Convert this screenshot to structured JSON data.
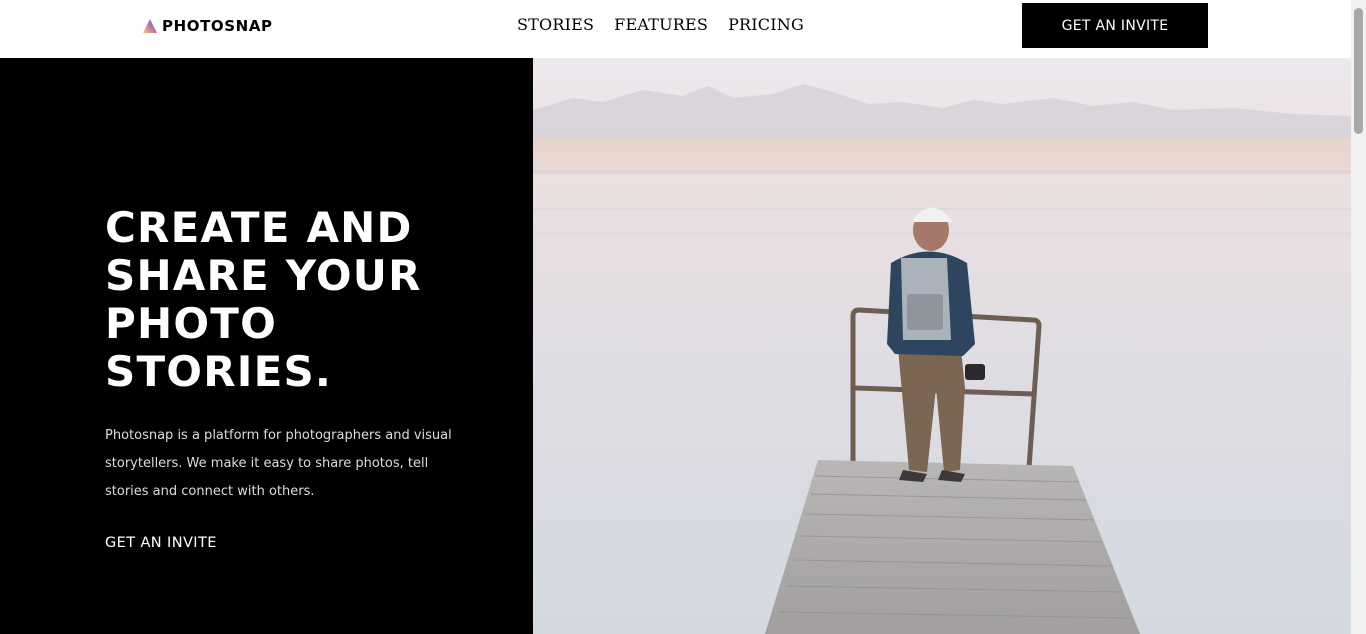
{
  "header": {
    "logo_text": "PHOTOSNAP",
    "nav": [
      {
        "label": "STORIES"
      },
      {
        "label": "FEATURES"
      },
      {
        "label": "PRICING"
      }
    ],
    "cta_label": "GET AN INVITE"
  },
  "hero": {
    "title": "CREATE AND SHARE YOUR PHOTO STORIES.",
    "description": "Photosnap is a platform for photographers and visual storytellers. We make it easy to share photos, tell stories and connect with others.",
    "link_label": "GET AN INVITE"
  },
  "colors": {
    "background_dark": "#000000",
    "text_light": "#ffffff",
    "logo_gradient_start": "#ffc593",
    "logo_gradient_mid": "#bc7198",
    "logo_gradient_end": "#5a77ff"
  }
}
